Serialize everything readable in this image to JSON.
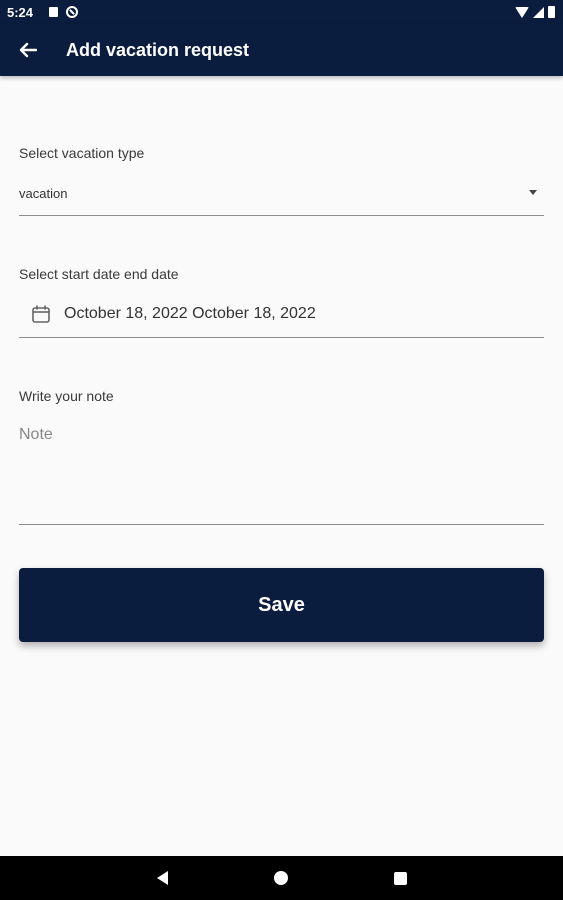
{
  "status_bar": {
    "time": "5:24"
  },
  "app_bar": {
    "title": "Add vacation request",
    "back_icon": "arrow-left-icon"
  },
  "form": {
    "vacation_type": {
      "label": "Select vacation type",
      "value": "vacation"
    },
    "dates": {
      "label": "Select start date end date",
      "value": "October 18, 2022 October 18, 2022",
      "icon": "calendar-icon"
    },
    "note": {
      "label": "Write your note",
      "placeholder": "Note",
      "value": ""
    },
    "save_label": "Save"
  },
  "colors": {
    "primary": "#0b1d3f",
    "background": "#fafafa",
    "underline": "#8d8d8d"
  }
}
